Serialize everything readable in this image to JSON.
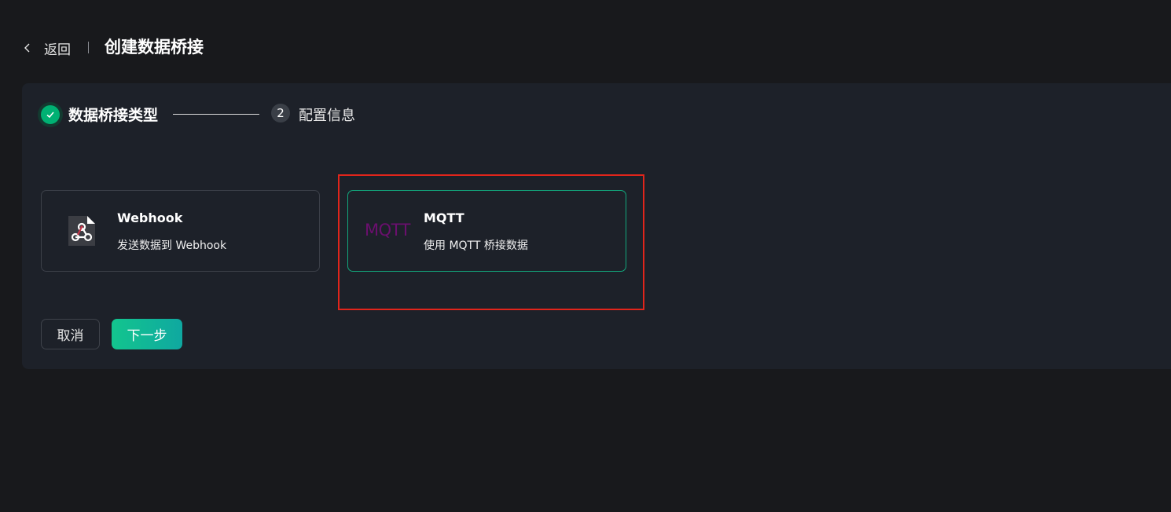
{
  "header": {
    "back_label": "返回",
    "title": "创建数据桥接"
  },
  "steps": [
    {
      "label": "数据桥接类型",
      "state": "done"
    },
    {
      "number": "2",
      "label": "配置信息",
      "state": "pending"
    }
  ],
  "options": [
    {
      "name": "Webhook",
      "desc": "发送数据到 Webhook",
      "icon": "webhook-icon",
      "selected": false
    },
    {
      "name": "MQTT",
      "desc": "使用 MQTT 桥接数据",
      "icon": "mqtt-logo",
      "logo_text": "MQTT",
      "selected": true
    }
  ],
  "buttons": {
    "cancel": "取消",
    "next": "下一步"
  },
  "colors": {
    "accent": "#00b173",
    "selected_border": "#12a77c",
    "highlight_box": "#e1251b",
    "mqtt_logo": "#6b0f6e"
  }
}
